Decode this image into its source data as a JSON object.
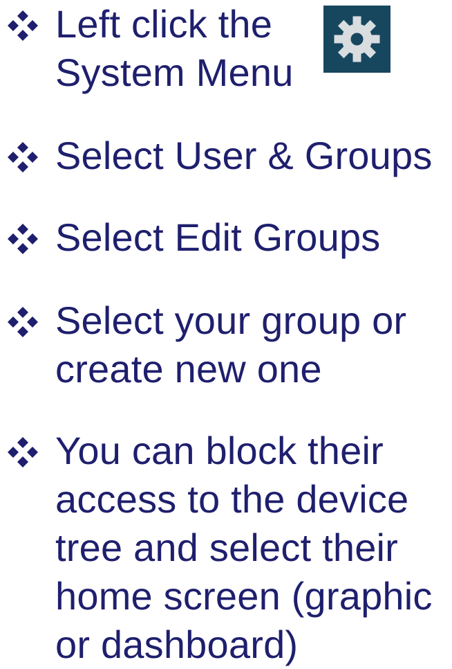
{
  "bullets": [
    {
      "lines": [
        "Left click the",
        "System Menu"
      ]
    },
    {
      "lines": [
        "Select User & Groups"
      ]
    },
    {
      "lines": [
        "Select Edit Groups"
      ]
    },
    {
      "lines": [
        "Select your group or",
        "create new one"
      ]
    },
    {
      "lines": [
        "You can block their",
        "access to the device",
        "tree and select their",
        "home screen (graphic",
        "or dashboard)"
      ]
    }
  ],
  "icons": {
    "bullet": "four-diamond-bullet-icon",
    "system_menu": "gear-icon"
  },
  "colors": {
    "text": "#1f1f6e",
    "bullet": "#1f1f6e",
    "gear_background": "#17475f",
    "gear": "#d9dde0"
  }
}
